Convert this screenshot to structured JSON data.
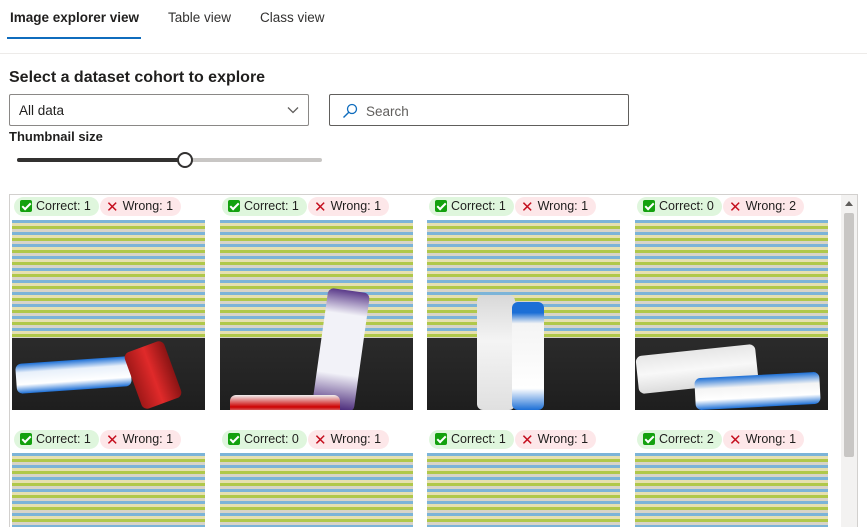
{
  "tabs": [
    {
      "label": "Image explorer view",
      "active": true
    },
    {
      "label": "Table view",
      "active": false
    },
    {
      "label": "Class view",
      "active": false
    }
  ],
  "cohort": {
    "label": "Select a dataset cohort to explore",
    "selected": "All data"
  },
  "search": {
    "placeholder": "Search",
    "value": ""
  },
  "thumbnail": {
    "label": "Thumbnail size",
    "slider_value_fraction": 0.55
  },
  "gallery": {
    "items": [
      {
        "correct": "Correct: 1",
        "wrong": "Wrong: 1",
        "scene": "milk-and-can"
      },
      {
        "correct": "Correct: 1",
        "wrong": "Wrong: 1",
        "scene": "carton"
      },
      {
        "correct": "Correct: 1",
        "wrong": "Wrong: 1",
        "scene": "two-bottles"
      },
      {
        "correct": "Correct: 0",
        "wrong": "Wrong: 2",
        "scene": "hint-bottles"
      },
      {
        "correct": "Correct: 1",
        "wrong": "Wrong: 1",
        "scene": "partial"
      },
      {
        "correct": "Correct: 0",
        "wrong": "Wrong: 1",
        "scene": "partial"
      },
      {
        "correct": "Correct: 1",
        "wrong": "Wrong: 1",
        "scene": "partial"
      },
      {
        "correct": "Correct: 2",
        "wrong": "Wrong: 1",
        "scene": "partial"
      }
    ]
  },
  "colors": {
    "accent": "#0f6cbd",
    "correct_bg": "#dff6dd",
    "wrong_bg": "#fde7e9",
    "check": "#13a10e",
    "wrong_icon": "#c50f1f"
  }
}
